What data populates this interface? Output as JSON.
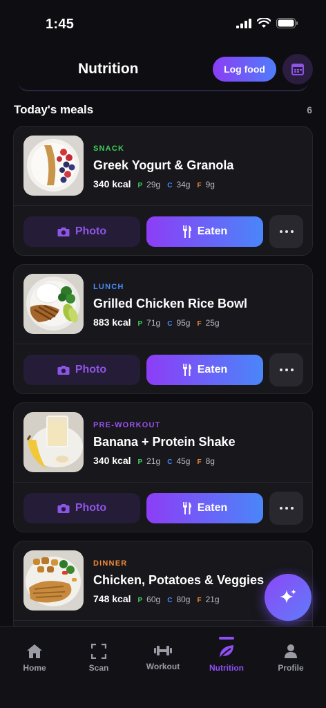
{
  "status_bar": {
    "time": "1:45"
  },
  "header": {
    "title": "Nutrition",
    "log_food_label": "Log food"
  },
  "section": {
    "title": "Today's meals",
    "count": "6"
  },
  "colors": {
    "accent": "#8f4ff4",
    "protein": "#3ecf5a",
    "carbs": "#4a8bf7",
    "fat": "#f08a3c"
  },
  "meals": [
    {
      "type": "SNACK",
      "type_color": "#3ecf5a",
      "name": "Greek Yogurt & Granola",
      "kcal": "340 kcal",
      "p_label": "P",
      "p": "29g",
      "c_label": "C",
      "c": "34g",
      "f_label": "F",
      "f": "9g",
      "photo_label": "Photo",
      "eaten_label": "Eaten"
    },
    {
      "type": "LUNCH",
      "type_color": "#4a8bf7",
      "name": "Grilled Chicken Rice Bowl",
      "kcal": "883 kcal",
      "p_label": "P",
      "p": "71g",
      "c_label": "C",
      "c": "95g",
      "f_label": "F",
      "f": "25g",
      "photo_label": "Photo",
      "eaten_label": "Eaten"
    },
    {
      "type": "PRE-WORKOUT",
      "type_color": "#9a52f0",
      "name": "Banana + Protein Shake",
      "kcal": "340 kcal",
      "p_label": "P",
      "p": "21g",
      "c_label": "C",
      "c": "45g",
      "f_label": "F",
      "f": "8g",
      "photo_label": "Photo",
      "eaten_label": "Eaten"
    },
    {
      "type": "DINNER",
      "type_color": "#f08a3c",
      "name": "Chicken, Potatoes & Veggies",
      "kcal": "748 kcal",
      "p_label": "P",
      "p": "60g",
      "c_label": "C",
      "c": "80g",
      "f_label": "F",
      "f": "21g"
    }
  ],
  "tabs": [
    {
      "label": "Home",
      "icon": "home-icon"
    },
    {
      "label": "Scan",
      "icon": "scan-icon"
    },
    {
      "label": "Workout",
      "icon": "dumbbell-icon"
    },
    {
      "label": "Nutrition",
      "icon": "leaf-icon",
      "active": true
    },
    {
      "label": "Profile",
      "icon": "person-icon"
    }
  ]
}
